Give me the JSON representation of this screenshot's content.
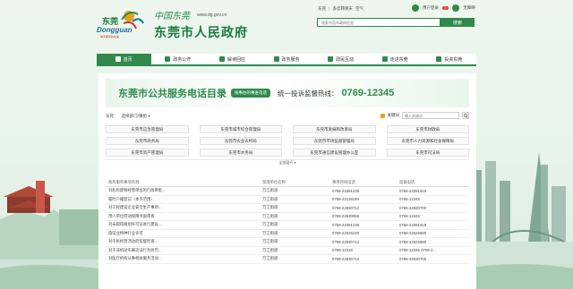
{
  "header": {
    "logo_cn": "东莞",
    "logo_en": "Dongguan",
    "logo_slogan": "每天都有新机遇",
    "site_cn": "中国东莞",
    "site_url": "www.dg.gov.cn",
    "site_name": "东莞市人民政府",
    "toplinks": [
      "东莞",
      "多云转阴天",
      "空气"
    ],
    "user_label": "用户登录",
    "mail_label": "无障碍",
    "badge": "▢",
    "search_placeholder": "搜索东莞市政府信息",
    "search_button": "搜索"
  },
  "nav": [
    {
      "label": "首页",
      "active": true
    },
    {
      "label": "政务公开",
      "active": false
    },
    {
      "label": "解读回应",
      "active": false
    },
    {
      "label": "政务服务",
      "active": false
    },
    {
      "label": "政民互动",
      "active": false
    },
    {
      "label": "走进东莞",
      "active": false
    },
    {
      "label": "投资东莞",
      "active": false
    }
  ],
  "banner": {
    "title": "东莞市公共服务电话目录",
    "tag": "按事办的事查电话",
    "hotline_label": "统一投诉监督热线：",
    "hotline": "0769-12345"
  },
  "filter": {
    "label": "东莞：",
    "select": "选择部门/镇街 ▾",
    "keyword_label": "关键词",
    "keyword_placeholder": "输入关键词"
  },
  "departments": [
    "东莞市应急管理局",
    "东莞市城市综合管理局",
    "东莞市发展和改革局",
    "东莞市财政局",
    "东莞市商务局",
    "东莞市农业农村局",
    "东莞市市场监督管理局",
    "东莞市人力资源和社会保障局",
    "东莞市资产管理局",
    "东莞市水务局",
    "东莞市通信建设管理办公室",
    "东莞市司法局"
  ],
  "expand_label": "全部展开 ▾",
  "table": {
    "headers": [
      "政务服务事项名称",
      "受理单位名称",
      "事项咨询电话",
      "监督电话"
    ],
    "rows": [
      [
        "对危险废物经营单位的行政审批...",
        "万江街道",
        "0769-23391239",
        "0769-23391919"
      ],
      [
        "临时户籍登记（本市范围）",
        "万江街道",
        "0769-22118199",
        "0769-12345"
      ],
      [
        "对工程建设企业安全生产事项...",
        "万江街道",
        "0769-22830712",
        "0769-22830700"
      ],
      [
        "用人单位劳动保障书面审查",
        "万江街道",
        "0769-22630856",
        "0769-12345"
      ],
      [
        "对未取得规划许可证进行建设...",
        "万江街道",
        "0769-23391239",
        "0769-23391919"
      ],
      [
        "旅馆业特种行业许可",
        "万江街道",
        "0769-22625220",
        "0769-22625880"
      ],
      [
        "对市民经营活动的监督检查...",
        "万江街道",
        "0769-22830712",
        "0769-22825880"
      ],
      [
        "对于非机动车辆违法行为处罚...",
        "万江街道",
        "0769-12318",
        "0769-12345 0769-2..."
      ],
      [
        "对医疗机构从事相关服务活动...",
        "万江街道",
        "0769-22830712",
        "0769-22830700"
      ]
    ]
  },
  "colors": {
    "brand": "#2f8a4c",
    "accent_red": "#e23b3b"
  }
}
